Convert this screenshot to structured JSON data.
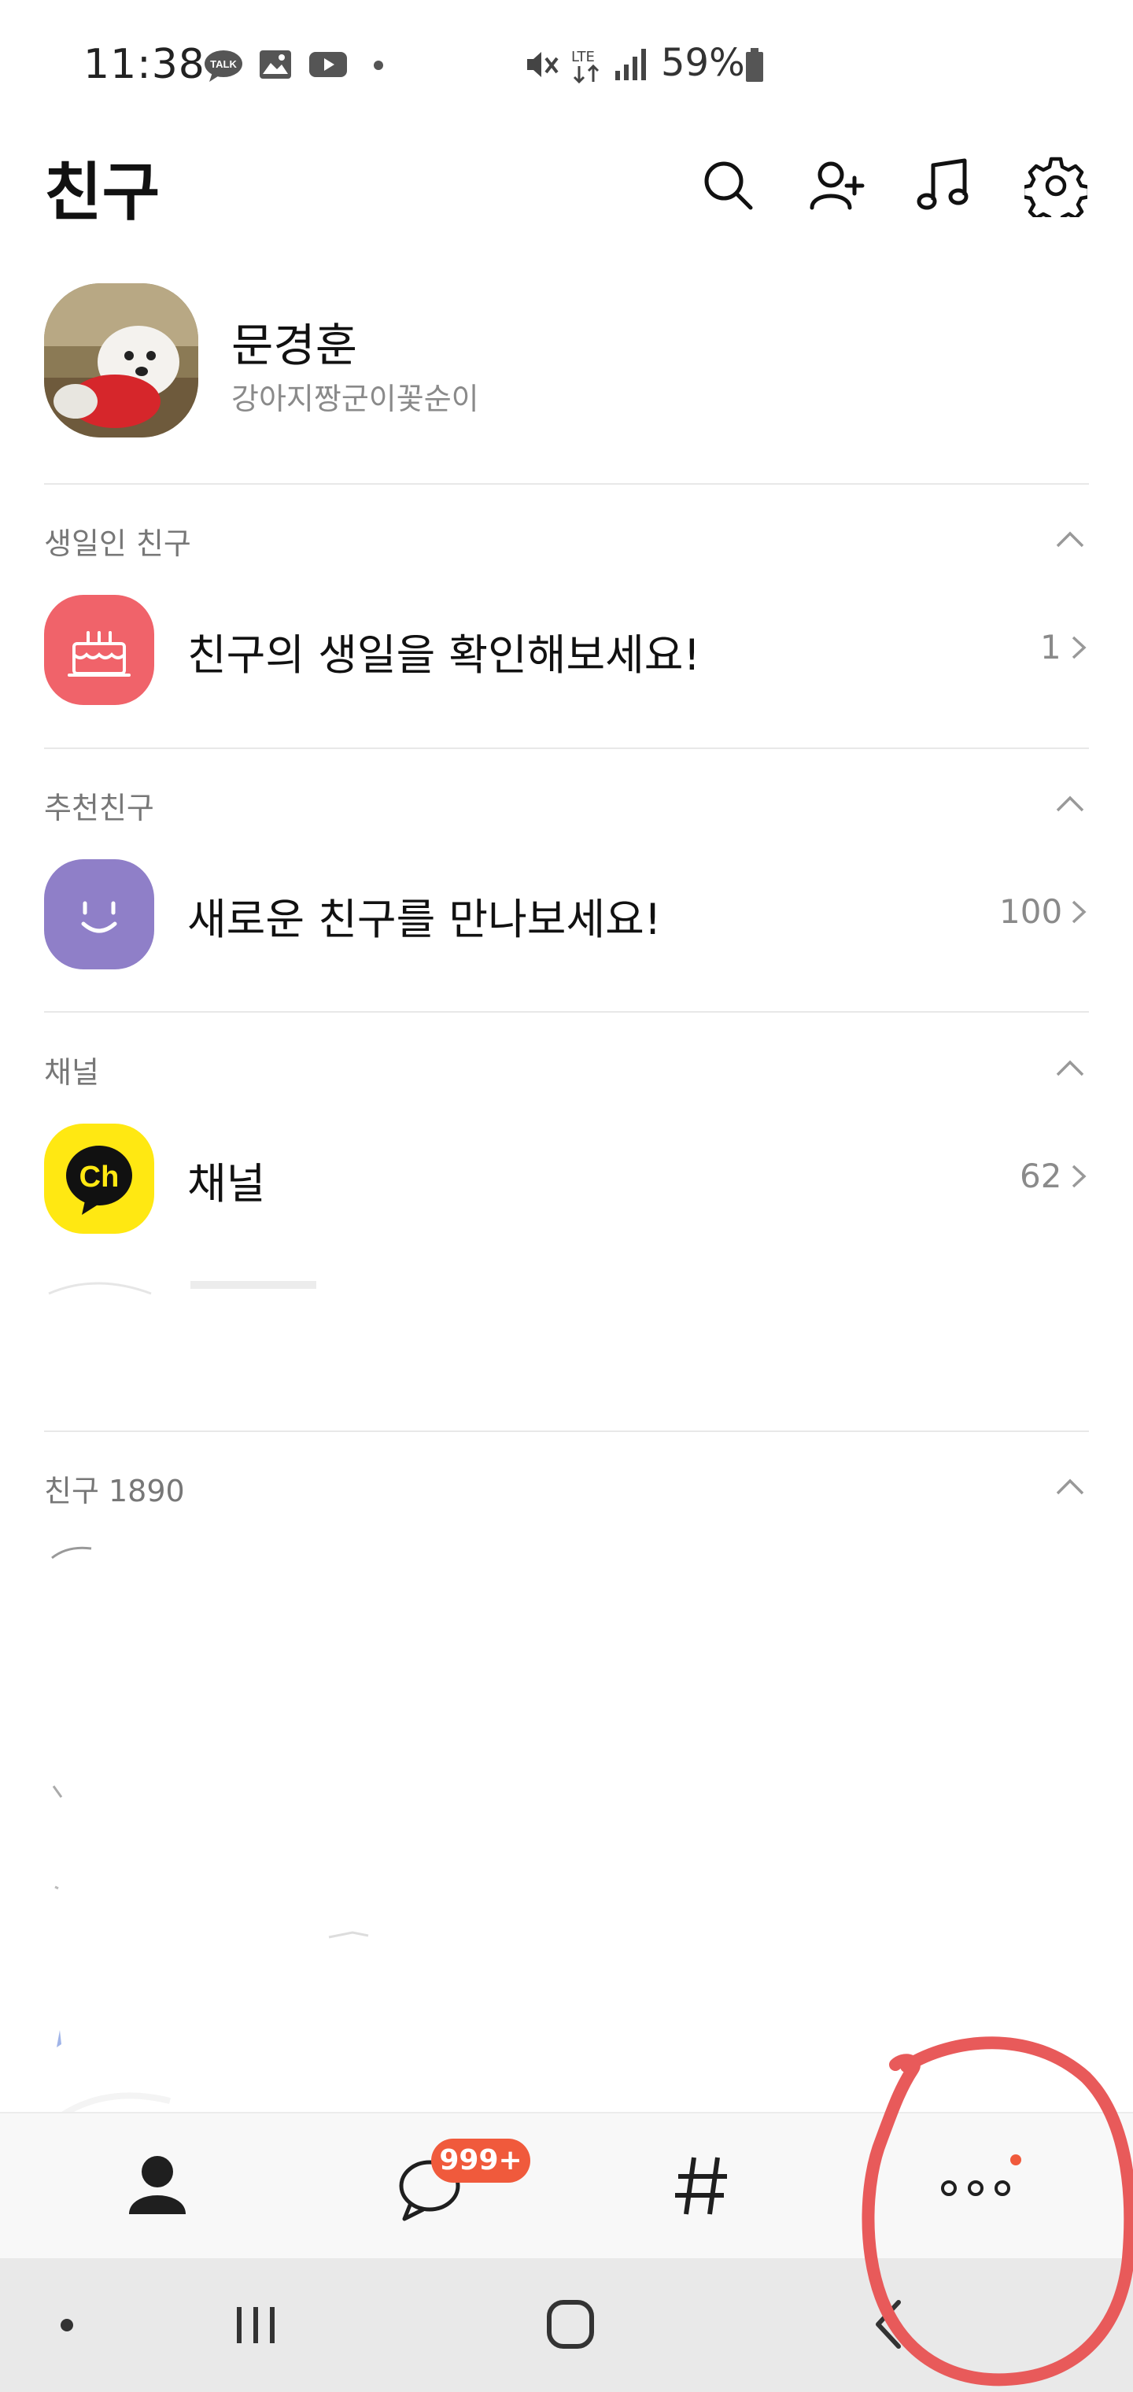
{
  "status_bar": {
    "time": "11:38",
    "talk_badge": "TALK",
    "network": "LTE",
    "battery": "59%"
  },
  "header": {
    "title": "친구",
    "icons": [
      "search-icon",
      "add-friend-icon",
      "music-icon",
      "settings-icon"
    ]
  },
  "profile": {
    "name": "문경훈",
    "status_message": "강아지짱군이꽃순이"
  },
  "sections": {
    "birthday": {
      "title": "생일인 친구",
      "row_label": "친구의 생일을 확인해보세요!",
      "count": "1"
    },
    "recommended": {
      "title": "추천친구",
      "row_label": "새로운 친구를 만나보세요!",
      "count": "100"
    },
    "channel": {
      "title": "채널",
      "row_label": "채널",
      "count": "62",
      "icon_text": "Ch"
    },
    "friends": {
      "title": "친구 1890"
    }
  },
  "bottom_nav": {
    "items": [
      "friends-tab",
      "chats-tab",
      "view-tab",
      "more-tab"
    ],
    "chat_badge": "999+"
  },
  "colors": {
    "accent_red": "#f05a3c",
    "birthday_bg": "#f0636a",
    "recommend_bg": "#8f7fc8",
    "channel_bg": "#ffe812",
    "annotation": "#e85a5a"
  }
}
